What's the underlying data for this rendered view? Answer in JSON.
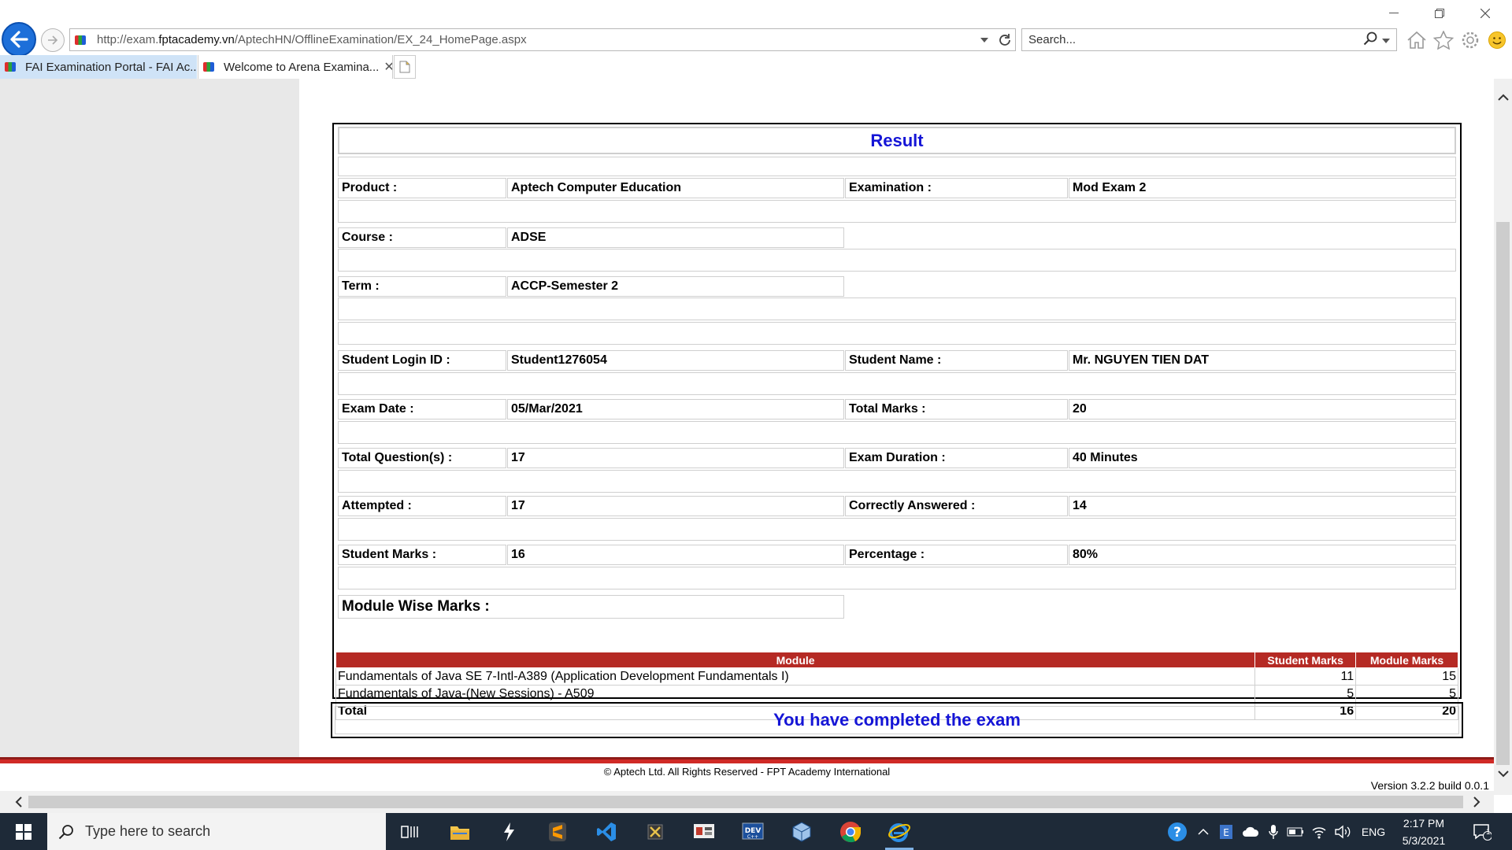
{
  "browser": {
    "url_prefix": "http://exam.",
    "url_domain": "fptacademy.vn",
    "url_path": "/AptechHN/OfflineExamination/EX_24_HomePage.aspx",
    "search_placeholder": "Search...",
    "tabs": [
      {
        "label": "FAI Examination Portal - FAI Ac...",
        "active": false
      },
      {
        "label": "Welcome to Arena Examina...",
        "active": true
      }
    ]
  },
  "result": {
    "title": "Result",
    "rows": [
      {
        "l1": "Product :",
        "v1": "Aptech Computer Education",
        "l2": "Examination :",
        "v2": "Mod Exam 2"
      },
      {
        "l1": "Course :",
        "v1": "ADSE"
      },
      {
        "l1": "Term :",
        "v1": "ACCP-Semester 2"
      },
      {
        "l1": "Student Login ID :",
        "v1": "Student1276054",
        "l2": "Student Name :",
        "v2": "Mr. NGUYEN TIEN DAT"
      },
      {
        "l1": "Exam Date :",
        "v1": "05/Mar/2021",
        "l2": "Total Marks :",
        "v2": "20"
      },
      {
        "l1": "Total Question(s) :",
        "v1": "17",
        "l2": "Exam Duration :",
        "v2": "40 Minutes"
      },
      {
        "l1": "Attempted :",
        "v1": "17",
        "l2": "Correctly Answered :",
        "v2": "14"
      },
      {
        "l1": "Student Marks :",
        "v1": "16",
        "l2": "Percentage :",
        "v2": "80%"
      }
    ],
    "module_wise_label": "Module Wise Marks :",
    "module_table": {
      "headers": [
        "Module",
        "Student Marks",
        "Module Marks"
      ],
      "rows": [
        [
          "Fundamentals of Java SE 7-Intl-A389 (Application Development Fundamentals I)",
          "11",
          "15"
        ],
        [
          "Fundamentals of Java-(New Sessions) - A509",
          "5",
          "5"
        ]
      ],
      "total": [
        "Total",
        "16",
        "20"
      ]
    },
    "completed_message": "You have completed the exam"
  },
  "footer": {
    "copyright": "© Aptech Ltd. All Rights Reserved - FPT Academy International",
    "version": "Version 3.2.2 build 0.0.1"
  },
  "taskbar": {
    "search_placeholder": "Type here to search",
    "language": "ENG",
    "time": "2:17 PM",
    "date": "5/3/2021",
    "notification_count": "1"
  },
  "colors": {
    "header_red": "#b52a24",
    "title_blue": "#1515d6",
    "taskbar": "#1e2a38"
  }
}
